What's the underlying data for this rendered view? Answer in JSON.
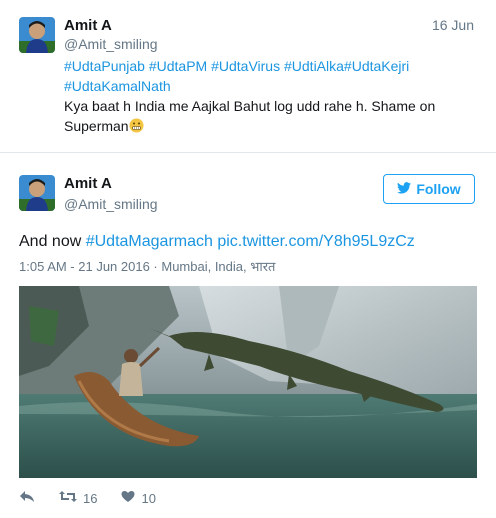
{
  "tweet1": {
    "name": "Amit A",
    "handle": "@Amit_smiling",
    "date": "16 Jun",
    "hashtags_line1": [
      "#UdtaPunjab",
      "#UdtaPM",
      "#UdtaVirus",
      "#UdtiAlka",
      "#UdtaKejri"
    ],
    "hashtags_line2": [
      "#UdtaKamalNath"
    ],
    "text": "Kya baat h India me Aajkal Bahut log udd rahe h. Shame on Superman",
    "emoji": "grimacing-face-emoji"
  },
  "tweet2": {
    "name": "Amit A",
    "handle": "@Amit_smiling",
    "follow_label": "Follow",
    "text_prefix": "And now",
    "hashtag": "#UdtaMagarmach",
    "link": "pic.twitter.com/Y8h95L9zCz",
    "meta": "1:05 AM - 21 Jun 2016 · Mumbai, India, भारत",
    "retweet_count": "16",
    "like_count": "10",
    "icons": [
      "reply-icon",
      "retweet-icon",
      "heart-icon",
      "twitter-bird-icon"
    ]
  },
  "colors": {
    "link": "#1b95e0",
    "follow": "#1da1f2",
    "muted": "#657786",
    "divider": "#e1e8ed"
  }
}
